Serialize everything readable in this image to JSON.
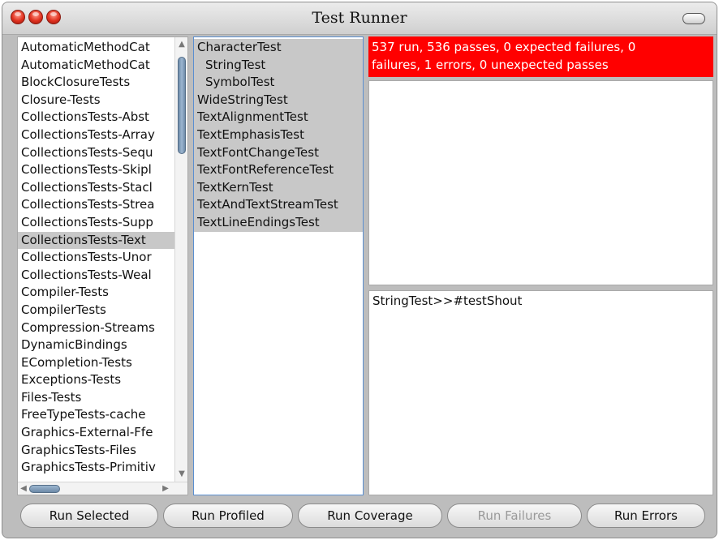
{
  "window": {
    "title": "Test Runner"
  },
  "packages": [
    "AutomaticMethodCat",
    "AutomaticMethodCat",
    "BlockClosureTests",
    "Closure-Tests",
    "CollectionsTests-Abst",
    "CollectionsTests-Array",
    "CollectionsTests-Sequ",
    "CollectionsTests-Skipl",
    "CollectionsTests-Stacl",
    "CollectionsTests-Strea",
    "CollectionsTests-Supp",
    "CollectionsTests-Text",
    "CollectionsTests-Unor",
    "CollectionsTests-Weal",
    "Compiler-Tests",
    "CompilerTests",
    "Compression-Streams",
    "DynamicBindings",
    "ECompletion-Tests",
    "Exceptions-Tests",
    "Files-Tests",
    "FreeTypeTests-cache",
    "Graphics-External-Ffe",
    "GraphicsTests-Files",
    "GraphicsTests-Primitiv"
  ],
  "selected_package": "CollectionsTests-Text",
  "classes": [
    "CharacterTest",
    "StringTest",
    "SymbolTest",
    "WideStringTest",
    "TextAlignmentTest",
    "TextEmphasisTest",
    "TextFontChangeTest",
    "TextFontReferenceTest",
    "TextKernTest",
    "TextAndTextStreamTest",
    "TextLineEndingsTest"
  ],
  "status": {
    "line1": "537 run, 536 passes, 0 expected failures, 0",
    "line2": "failures, 1 errors, 0 unexpected passes",
    "color": "#ff0000"
  },
  "errors_list": [
    "StringTest>>#testShout"
  ],
  "buttons": {
    "run_selected": "Run Selected",
    "run_profiled": "Run Profiled",
    "run_coverage": "Run Coverage",
    "run_failures": "Run Failures",
    "run_errors": "Run Errors"
  }
}
